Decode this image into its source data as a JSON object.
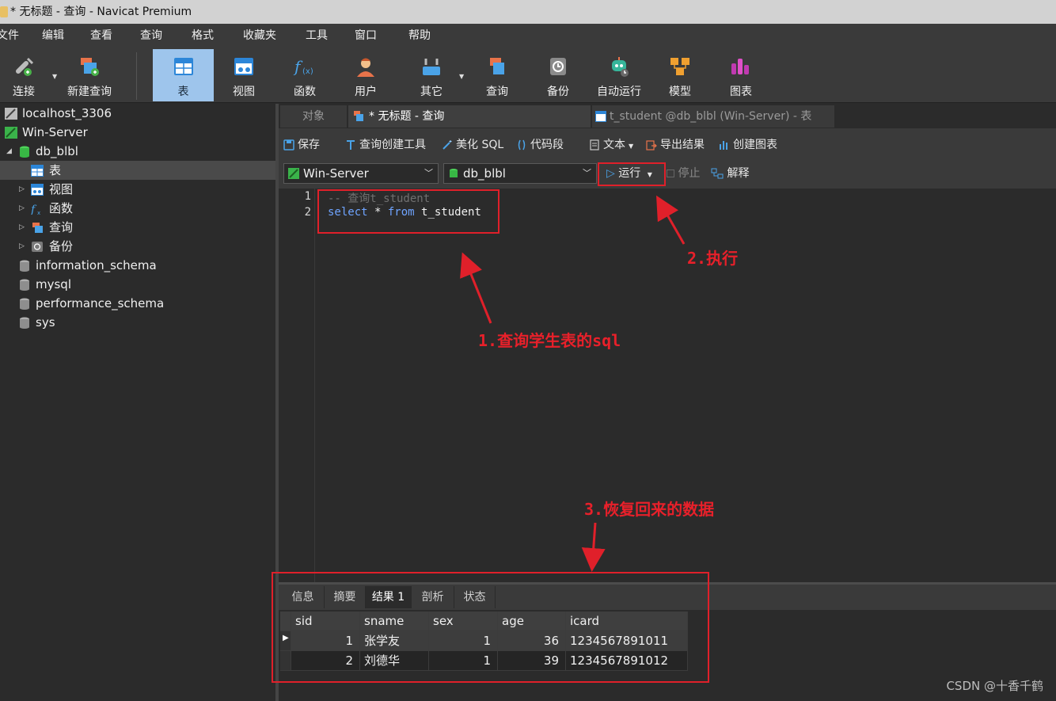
{
  "window": {
    "title": "* 无标题 - 查询 - Navicat Premium"
  },
  "menu": [
    "文件",
    "编辑",
    "查看",
    "查询",
    "格式",
    "收藏夹",
    "工具",
    "窗口",
    "帮助"
  ],
  "toolbar": {
    "connect": "连接",
    "new_query": "新建查询",
    "table": "表",
    "view": "视图",
    "function": "函数",
    "user": "用户",
    "other": "其它",
    "query": "查询",
    "backup": "备份",
    "automation": "自动运行",
    "model": "模型",
    "chart": "图表"
  },
  "tree": {
    "conn1": "localhost_3306",
    "conn2": "Win-Server",
    "db": "db_blbl",
    "tables": "表",
    "views": "视图",
    "functions": "函数",
    "queries": "查询",
    "backups": "备份",
    "db2": "information_schema",
    "db3": "mysql",
    "db4": "performance_schema",
    "db5": "sys"
  },
  "tabs": {
    "objects": "对象",
    "query": "* 无标题 - 查询",
    "table": "t_student @db_blbl (Win-Server) - 表"
  },
  "query_toolbar": {
    "save": "保存",
    "builder": "查询创建工具",
    "beautify": "美化 SQL",
    "snippet": "代码段",
    "text": "文本",
    "export": "导出结果",
    "create_chart": "创建图表"
  },
  "connbar": {
    "connection": "Win-Server",
    "database": "db_blbl",
    "run": "运行",
    "stop": "停止",
    "explain": "解释"
  },
  "editor": {
    "line1_num": "1",
    "line2_num": "2",
    "line1": "-- 查询t_student",
    "kw_select": "select",
    "star": " * ",
    "kw_from": "from",
    "table": " t_student"
  },
  "result_tabs": [
    "信息",
    "摘要",
    "结果 1",
    "剖析",
    "状态"
  ],
  "grid": {
    "columns": [
      "sid",
      "sname",
      "sex",
      "age",
      "icard"
    ],
    "rows": [
      [
        "1",
        "张学友",
        "1",
        "36",
        "1234567891011"
      ],
      [
        "2",
        "刘德华",
        "1",
        "39",
        "1234567891012"
      ]
    ]
  },
  "annotations": {
    "step1": "1.查询学生表的sql",
    "step2": "2.执行",
    "step3": "3.恢复回来的数据",
    "color": "#e0202a"
  },
  "watermark": "CSDN @十香千鹤"
}
